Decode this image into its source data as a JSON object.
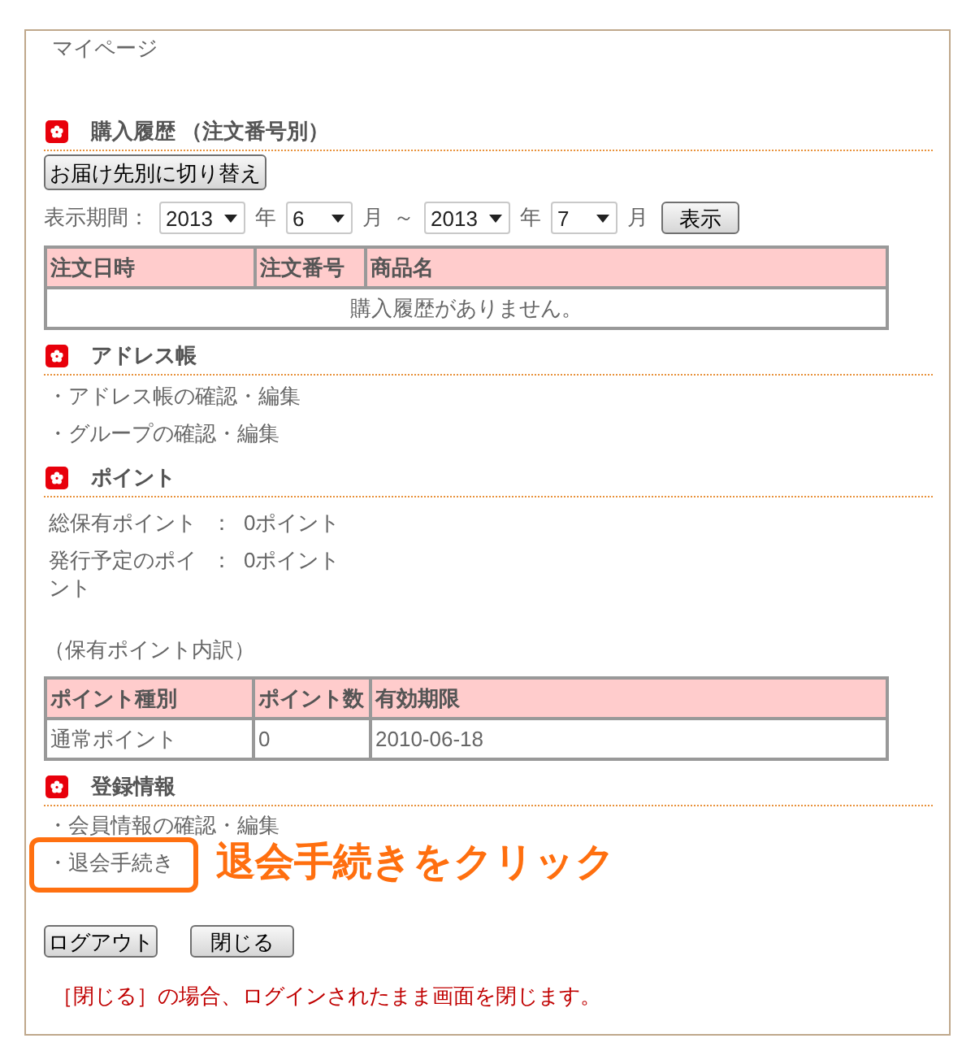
{
  "page": {
    "title": "マイページ"
  },
  "purchase_history": {
    "heading": "購入履歴 （注文番号別）",
    "toggle_button": "お届け先別に切り替え",
    "period": [
      {
        "kind": "label",
        "text": "表示期間："
      },
      {
        "kind": "select",
        "value": "2013"
      },
      {
        "kind": "text",
        "text": "年"
      },
      {
        "kind": "select",
        "value": "6"
      },
      {
        "kind": "text",
        "text": "月"
      },
      {
        "kind": "text",
        "text": "～"
      },
      {
        "kind": "select",
        "value": "2013"
      },
      {
        "kind": "text",
        "text": "年"
      },
      {
        "kind": "select",
        "value": "7"
      },
      {
        "kind": "text",
        "text": "月"
      },
      {
        "kind": "button",
        "text": "表示"
      }
    ],
    "table": {
      "columns": [
        "注文日時",
        "注文番号",
        "商品名"
      ],
      "empty_message": "購入履歴がありません。"
    }
  },
  "address_book": {
    "heading": "アドレス帳",
    "links": [
      "・アドレス帳の確認・編集",
      "・グループの確認・編集"
    ]
  },
  "points": {
    "heading": "ポイント",
    "rows": [
      {
        "label": "総保有ポイント",
        "separator": "：",
        "value": "0ポイント"
      },
      {
        "label": "発行予定のポイント",
        "separator": "：",
        "value": "0ポイント"
      }
    ],
    "breakdown_caption": "（保有ポイント内訳）",
    "table": {
      "columns": [
        "ポイント種別",
        "ポイント数",
        "有効期限"
      ],
      "rows": [
        [
          "通常ポイント",
          "0",
          "2010-06-18"
        ]
      ]
    }
  },
  "registration": {
    "heading": "登録情報",
    "links": [
      {
        "text": "・会員情報の確認・編集",
        "highlighted": false
      },
      {
        "text": "・退会手続き",
        "highlighted": true,
        "callout": "退会手続きをクリック"
      }
    ]
  },
  "footer": {
    "buttons": [
      "ログアウト",
      "閉じる"
    ],
    "note": "［閉じる］の場合、ログインされたまま画面を閉じます。"
  }
}
